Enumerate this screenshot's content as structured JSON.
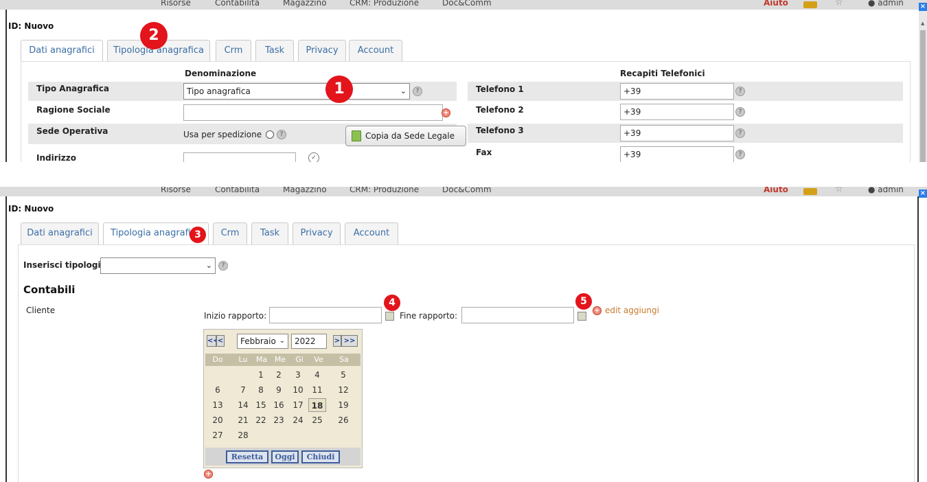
{
  "topbar": {
    "menu": [
      "Risorse",
      "Contabilità",
      "Magazzino",
      "CRM: Produzione",
      "Doc&Comm"
    ],
    "help_label": "Aiuto",
    "user_label": "admin",
    "close_glyph": "×"
  },
  "icons": {
    "folder": "folder-icon",
    "star": "star-icon",
    "user": "user-icon",
    "help": "help-icon",
    "add": "add-icon",
    "calendar": "calendar-icon",
    "copy": "copy-document-icon"
  },
  "colors": {
    "badge": "#e3141b",
    "tab_text": "#3a6ea5",
    "aiuto": "#c0392b",
    "link": "#c87a2e"
  },
  "panel1": {
    "id_label": "ID: Nuovo",
    "tabs": [
      "Dati anagrafici",
      "Tipologia anagrafica",
      "Crm",
      "Task",
      "Privacy",
      "Account"
    ],
    "active_tab": "Dati anagrafici",
    "headers": {
      "denominazione": "Denominazione",
      "recapiti": "Recapiti Telefonici"
    },
    "fields": {
      "tipo_anagrafica": {
        "label": "Tipo Anagrafica",
        "value": "Tipo anagrafica"
      },
      "ragione_sociale": {
        "label": "Ragione Sociale",
        "value": ""
      },
      "sede_operativa": {
        "label": "Sede Operativa",
        "radio_label": "Usa per spedizione",
        "copy_button": "Copia da Sede Legale"
      },
      "indirizzo": {
        "label": "Indirizzo",
        "value": ""
      }
    },
    "phones": [
      {
        "label": "Telefono 1",
        "value": "+39"
      },
      {
        "label": "Telefono 2",
        "value": "+39"
      },
      {
        "label": "Telefono 3",
        "value": "+39"
      },
      {
        "label": "Fax",
        "value": "+39"
      }
    ],
    "badges": {
      "b1": "1",
      "b2": "2"
    }
  },
  "panel2": {
    "id_label": "ID: Nuovo",
    "tabs": [
      "Dati anagrafici",
      "Tipologia anagrafica",
      "Crm",
      "Task",
      "Privacy",
      "Account"
    ],
    "active_tab": "Tipologia anagrafica",
    "inserisci_label": "Inserisci tipologia",
    "inserisci_value": "",
    "section_title": "Contabili",
    "cliente_label": "Cliente",
    "inizio_label": "Inizio rapporto:",
    "inizio_value": "",
    "fine_label": "Fine rapporto:",
    "fine_value": "",
    "edit_link": "edit aggiungi",
    "badges": {
      "b3": "3",
      "b4": "4",
      "b5": "5"
    },
    "calendar": {
      "nav_prev": [
        "<<",
        "<"
      ],
      "nav_next": [
        ">",
        ">>"
      ],
      "month": "Febbraio",
      "year": "2022",
      "weekdays": [
        "Do",
        "Lu",
        "Ma",
        "Me",
        "Gi",
        "Ve",
        "Sa"
      ],
      "weeks": [
        [
          "",
          "",
          "1",
          "2",
          "3",
          "4",
          "5"
        ],
        [
          "6",
          "7",
          "8",
          "9",
          "10",
          "11",
          "12"
        ],
        [
          "13",
          "14",
          "15",
          "16",
          "17",
          "18",
          "19"
        ],
        [
          "20",
          "21",
          "22",
          "23",
          "24",
          "25",
          "26"
        ],
        [
          "27",
          "28",
          "",
          "",
          "",
          "",
          ""
        ]
      ],
      "today": "18",
      "buttons": [
        "Resetta",
        "Oggi",
        "Chiudi"
      ]
    }
  }
}
